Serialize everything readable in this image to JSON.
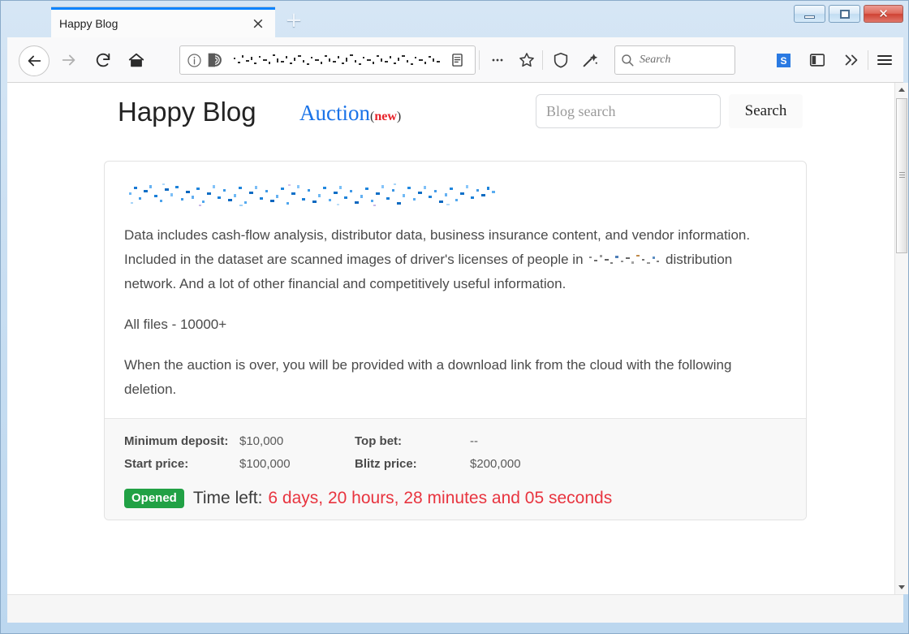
{
  "window": {
    "minimize_label": "Minimize",
    "maximize_label": "Maximize",
    "close_label": "Close"
  },
  "browser": {
    "tab": {
      "title": "Happy Blog",
      "close_label": "×"
    },
    "new_tab_label": "+",
    "nav": {
      "back_label": "←",
      "forward_label": "→",
      "reload_label": "⟳",
      "home_label": "⌂"
    },
    "address_bar": {
      "value": "",
      "identity_icon": "info-icon",
      "privacy_icon": "onion-icon",
      "reader_icon": "reader-view-icon"
    },
    "toolbar_icons": [
      "page-actions-icon",
      "bookmark-star-icon",
      "shield-icon",
      "tracking-protection-icon",
      "library-icon",
      "sidebar-icon",
      "overflow-chevron-icon",
      "hamburger-menu-icon"
    ],
    "search_bar": {
      "placeholder": "Search"
    },
    "extension_badge": "S"
  },
  "page": {
    "header": {
      "brand": "Happy Blog",
      "nav_link": "Auction",
      "nav_badge_open": "(",
      "nav_badge_text": "new",
      "nav_badge_close": ")",
      "search_placeholder": "Blog search",
      "search_value": "",
      "search_button": "Search"
    },
    "post": {
      "title_redacted": true,
      "paragraphs": [
        "Data includes cash-flow analysis, distributor data, business insurance content, and vendor information. Included in the dataset are scanned images of driver's licenses of people in",
        "distribution network. And a lot of other financial and competitively useful information.",
        "All files - 10000+",
        "When the auction is over, you will be provided with a download link from the cloud with the following deletion."
      ]
    },
    "auction_details": [
      {
        "label": "Minimum deposit:",
        "value": "$10,000"
      },
      {
        "label": "Top bet:",
        "value": "--"
      },
      {
        "label": "Start price:",
        "value": "$100,000"
      },
      {
        "label": "Blitz price:",
        "value": "$200,000"
      }
    ],
    "status": {
      "badge": "Opened",
      "time_label": "Time left:",
      "time_value": "6 days, 20 hours, 28 minutes and 05 seconds"
    }
  },
  "colors": {
    "tab_accent": "#0a84ff",
    "link_blue": "#1a73e8",
    "badge_red": "#e8232a",
    "status_green": "#21a145",
    "timer_red": "#e8343f"
  }
}
